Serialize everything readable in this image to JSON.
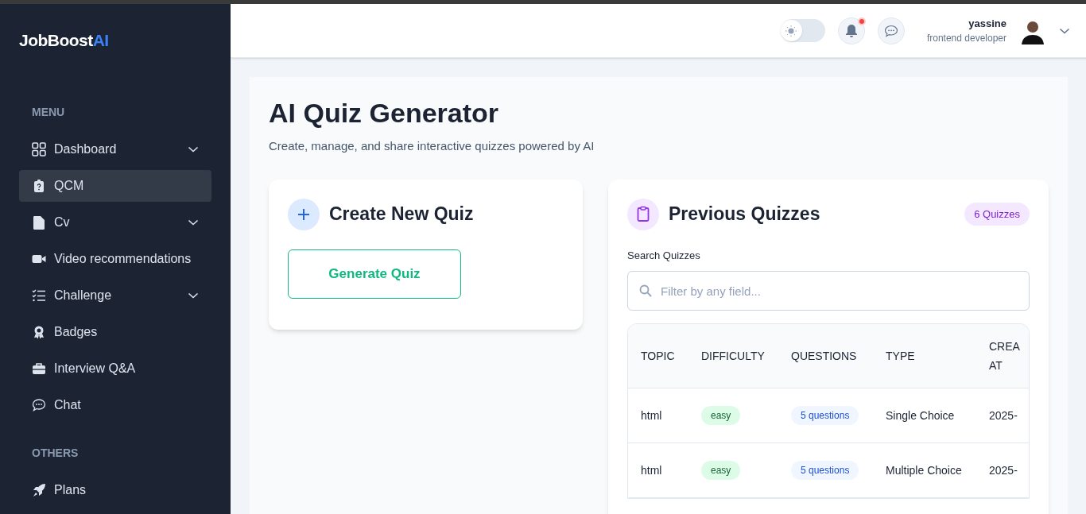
{
  "brand": {
    "text": "JobBoost",
    "accent": "AI"
  },
  "sidebar": {
    "sections": [
      {
        "title": "MENU",
        "items": [
          {
            "label": "Dashboard",
            "kind": "grid",
            "expandable": true,
            "selected": false
          },
          {
            "label": "QCM",
            "kind": "quiz",
            "expandable": false,
            "selected": true
          },
          {
            "label": "Cv",
            "kind": "file",
            "expandable": true,
            "selected": false
          },
          {
            "label": "Video recommendations",
            "kind": "video",
            "expandable": false,
            "selected": false
          },
          {
            "label": "Challenge",
            "kind": "list",
            "expandable": true,
            "selected": false
          },
          {
            "label": "Badges",
            "kind": "badge",
            "expandable": false,
            "selected": false
          },
          {
            "label": "Interview Q&A",
            "kind": "briefcase",
            "expandable": false,
            "selected": false
          },
          {
            "label": "Chat",
            "kind": "chat",
            "expandable": false,
            "selected": false
          }
        ]
      },
      {
        "title": "OTHERS",
        "items": [
          {
            "label": "Plans",
            "kind": "rocket",
            "expandable": false,
            "selected": false
          }
        ]
      }
    ]
  },
  "header": {
    "theme_toggle": {
      "on": false
    },
    "notifications": {
      "unread": true
    },
    "user": {
      "name": "yassine",
      "role": "frontend developer"
    }
  },
  "page": {
    "title": "AI Quiz Generator",
    "subtitle": "Create, manage, and share interactive quizzes powered by AI"
  },
  "create_card": {
    "title": "Create New Quiz",
    "button": "Generate Quiz"
  },
  "previous_card": {
    "title": "Previous Quizzes",
    "count": "6 Quizzes",
    "search_label": "Search Quizzes",
    "search_placeholder": "Filter by any field...",
    "table": {
      "columns": [
        "TOPIC",
        "DIFFICULTY",
        "QUESTIONS",
        "TYPE",
        "CREA AT"
      ],
      "rows": [
        {
          "topic": "html",
          "difficulty": "easy",
          "questions": "5 questions",
          "type": "Single Choice",
          "created": "2025-"
        },
        {
          "topic": "html",
          "difficulty": "easy",
          "questions": "5 questions",
          "type": "Multiple Choice",
          "created": "2025-"
        }
      ]
    }
  }
}
